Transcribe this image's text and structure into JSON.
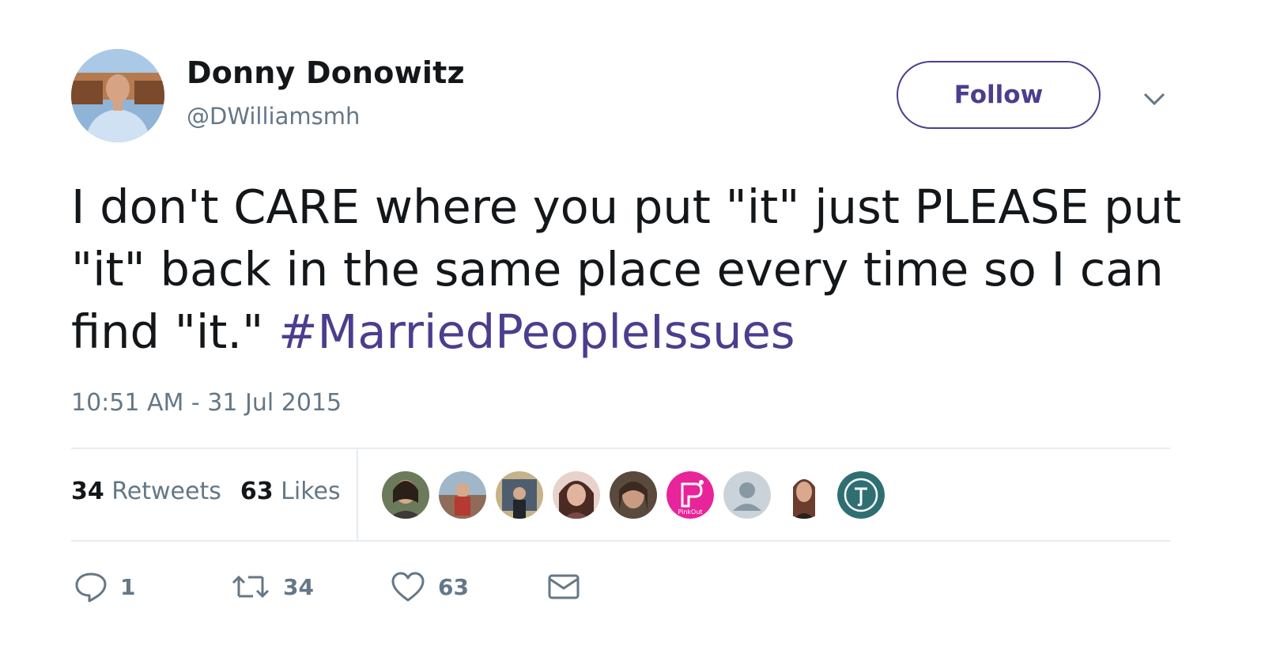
{
  "author": {
    "display_name": "Donny Donowitz",
    "handle": "@DWilliamsmh"
  },
  "follow_button": {
    "label": "Follow"
  },
  "tweet": {
    "text_before_hashtag": "I don't CARE where you put \"it\" just PLEASE put \"it\" back in the same place every time so I can find \"it.\" ",
    "hashtag": "#MarriedPeopleIssues",
    "timestamp": "10:51 AM - 31 Jul 2015"
  },
  "stats": {
    "retweets_count": "34",
    "retweets_label": "Retweets",
    "likes_count": "63",
    "likes_label": "Likes"
  },
  "likers": [
    {
      "icon": "user-avatar-photo",
      "color": "#6b7a5a"
    },
    {
      "icon": "user-avatar-photo",
      "color": "#8f6b5a"
    },
    {
      "icon": "user-avatar-photo",
      "color": "#4f5e6e"
    },
    {
      "icon": "user-avatar-photo",
      "color": "#7a4a4a"
    },
    {
      "icon": "user-avatar-photo",
      "color": "#5a4a3e"
    },
    {
      "icon": "planned-parenthood-logo",
      "color": "#e8249a",
      "text": "PinkOut"
    },
    {
      "icon": "default-avatar-icon",
      "color": "#cbd3da"
    },
    {
      "icon": "user-avatar-photo",
      "color": "#8a5d48"
    },
    {
      "icon": "brand-logo",
      "color": "#2f6f73"
    }
  ],
  "actions": {
    "reply": {
      "icon": "reply-icon",
      "count": "1"
    },
    "retweet": {
      "icon": "retweet-icon",
      "count": "34"
    },
    "like": {
      "icon": "heart-icon",
      "count": "63"
    },
    "message": {
      "icon": "envelope-icon"
    }
  },
  "colors": {
    "accent": "#4d3d8d",
    "secondary_text": "#657786",
    "divider": "#e6ecf0"
  }
}
